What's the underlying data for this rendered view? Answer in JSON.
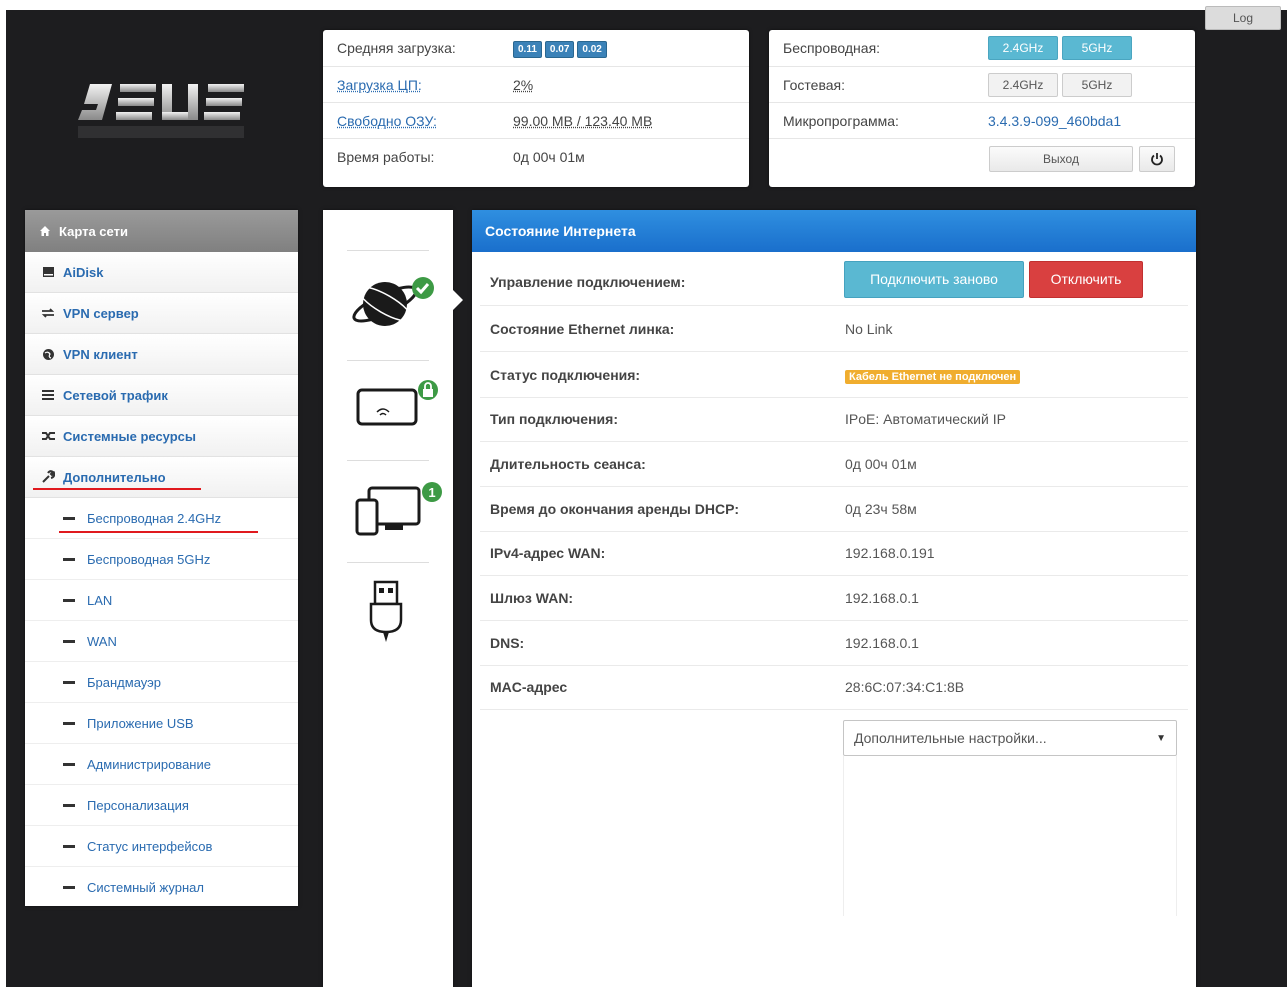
{
  "log_button": "Log",
  "logo_text": "ASUS",
  "status_left": {
    "avg_load_label": "Средняя загрузка:",
    "avg_load_values": [
      "0.11",
      "0.07",
      "0.02"
    ],
    "cpu_label": "Загрузка ЦП:",
    "cpu_value": "2%",
    "ram_label": "Свободно ОЗУ:",
    "ram_value": "99.00 MB / 123.40 MB",
    "uptime_label": "Время работы:",
    "uptime_value": "0д 00ч 01м"
  },
  "status_right": {
    "wireless_label": "Беспроводная:",
    "wireless_bands": [
      "2.4GHz",
      "5GHz"
    ],
    "guest_label": "Гостевая:",
    "guest_bands": [
      "2.4GHz",
      "5GHz"
    ],
    "firmware_label": "Микропрограмма:",
    "firmware_value": "3.4.3.9-099_460bda1",
    "exit_label": "Выход"
  },
  "sidebar": {
    "header": "Карта сети",
    "items": [
      {
        "label": "AiDisk",
        "icon": "disk-icon"
      },
      {
        "label": "VPN сервер",
        "icon": "vpn-server-icon"
      },
      {
        "label": "VPN клиент",
        "icon": "globe-icon"
      },
      {
        "label": "Сетевой трафик",
        "icon": "traffic-icon"
      },
      {
        "label": "Системные ресурсы",
        "icon": "resources-icon"
      },
      {
        "label": "Дополнительно",
        "icon": "wrench-icon"
      }
    ],
    "sub_items": [
      "Беспроводная 2.4GHz",
      "Беспроводная 5GHz",
      "LAN",
      "WAN",
      "Брандмауэр",
      "Приложение USB",
      "Администрирование",
      "Персонализация",
      "Статус интерфейсов",
      "Системный журнал"
    ]
  },
  "icon_column": {
    "items": [
      "internet-globe-icon",
      "wireless-clients-icon",
      "devices-icon",
      "usb-icon"
    ],
    "badges": [
      "check",
      "lock",
      "1"
    ]
  },
  "internet": {
    "title": "Состояние Интернета",
    "connection_control_label": "Управление подключением:",
    "reconnect_label": "Подключить заново",
    "disconnect_label": "Отключить",
    "ethernet_label": "Состояние Ethernet линка:",
    "ethernet_value": "No Link",
    "status_label": "Статус подключения:",
    "status_value": "Кабель Ethernet не подключен",
    "type_label": "Тип подключения:",
    "type_value": "IPoE: Автоматический IP",
    "session_label": "Длительность сеанса:",
    "session_value": "0д 00ч 01м",
    "lease_label": "Время до окончания аренды DHCP:",
    "lease_value": "0д 23ч 58м",
    "wan_ip_label": "IPv4-адрес WAN:",
    "wan_ip_value": "192.168.0.191",
    "gateway_label": "Шлюз WAN:",
    "gateway_value": "192.168.0.1",
    "dns_label": "DNS:",
    "dns_value": "192.168.0.1",
    "mac_label": "MAC-адрес",
    "mac_value": "28:6C:07:34:C1:8B",
    "advanced_select": "Дополнительные настройки..."
  },
  "colors": {
    "accent_blue": "#1a6fcc",
    "link_blue": "#2a6bb0",
    "reconnect": "#5ab8d2",
    "disconnect": "#d94040",
    "warning": "#f0ad2e",
    "annotation_red": "#e0191e"
  }
}
